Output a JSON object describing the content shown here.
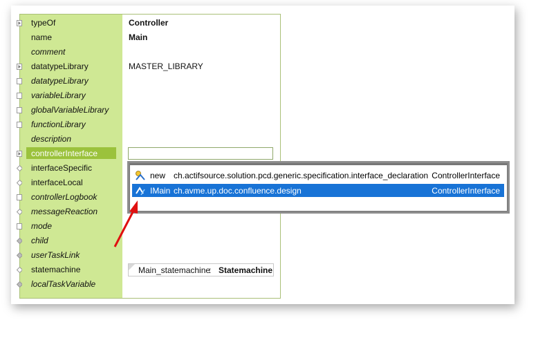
{
  "properties": [
    {
      "label": "typeOf",
      "italic": false,
      "marker": "expand",
      "value": "Controller",
      "bold": true
    },
    {
      "label": "name",
      "italic": false,
      "marker": "none",
      "value": "Main",
      "bold": true
    },
    {
      "label": "comment",
      "italic": true,
      "marker": "none",
      "value": ""
    },
    {
      "label": "datatypeLibrary",
      "italic": false,
      "marker": "expand",
      "value": "MASTER_LIBRARY",
      "bold": false
    },
    {
      "label": "datatypeLibrary",
      "italic": true,
      "marker": "box",
      "value": ""
    },
    {
      "label": "variableLibrary",
      "italic": true,
      "marker": "box",
      "value": ""
    },
    {
      "label": "globalVariableLibrary",
      "italic": true,
      "marker": "box",
      "value": ""
    },
    {
      "label": "functionLibrary",
      "italic": true,
      "marker": "box",
      "value": ""
    },
    {
      "label": "description",
      "italic": true,
      "marker": "none",
      "value": ""
    },
    {
      "label": "controllerInterface",
      "italic": false,
      "marker": "expand",
      "value": "",
      "selected": true
    },
    {
      "label": "interfaceSpecific",
      "italic": false,
      "marker": "diamond",
      "value": ""
    },
    {
      "label": "interfaceLocal",
      "italic": false,
      "marker": "diamond",
      "value": ""
    },
    {
      "label": "controllerLogbook",
      "italic": true,
      "marker": "box",
      "value": ""
    },
    {
      "label": "messageReaction",
      "italic": true,
      "marker": "diamond",
      "value": ""
    },
    {
      "label": "mode",
      "italic": true,
      "marker": "box",
      "value": ""
    },
    {
      "label": "child",
      "italic": true,
      "marker": "diamond-gray",
      "value": ""
    },
    {
      "label": "userTaskLink",
      "italic": true,
      "marker": "diamond-gray",
      "value": ""
    },
    {
      "label": "statemachine",
      "italic": false,
      "marker": "diamond",
      "value": ""
    },
    {
      "label": "localTaskVariable",
      "italic": true,
      "marker": "diamond-gray",
      "value": ""
    }
  ],
  "statemachine_box": {
    "name": "Main_statemachine",
    "sep": ":",
    "type": "Statemachine"
  },
  "popup": {
    "items": [
      {
        "prefix": "new",
        "text": "ch.actifsource.solution.pcd.generic.specification.interface_declaration",
        "type": "ControllerInterface",
        "selected": false,
        "icon": "new-icon"
      },
      {
        "prefix": "IMain",
        "text": "ch.avme.up.doc.confluence.design",
        "type": "ControllerInterface",
        "selected": true,
        "icon": "interface-icon"
      }
    ]
  },
  "colors": {
    "panel_green": "#cfe894",
    "selection_green": "#9bc23c",
    "popup_selection": "#1873d6",
    "arrow": "#e01010"
  }
}
